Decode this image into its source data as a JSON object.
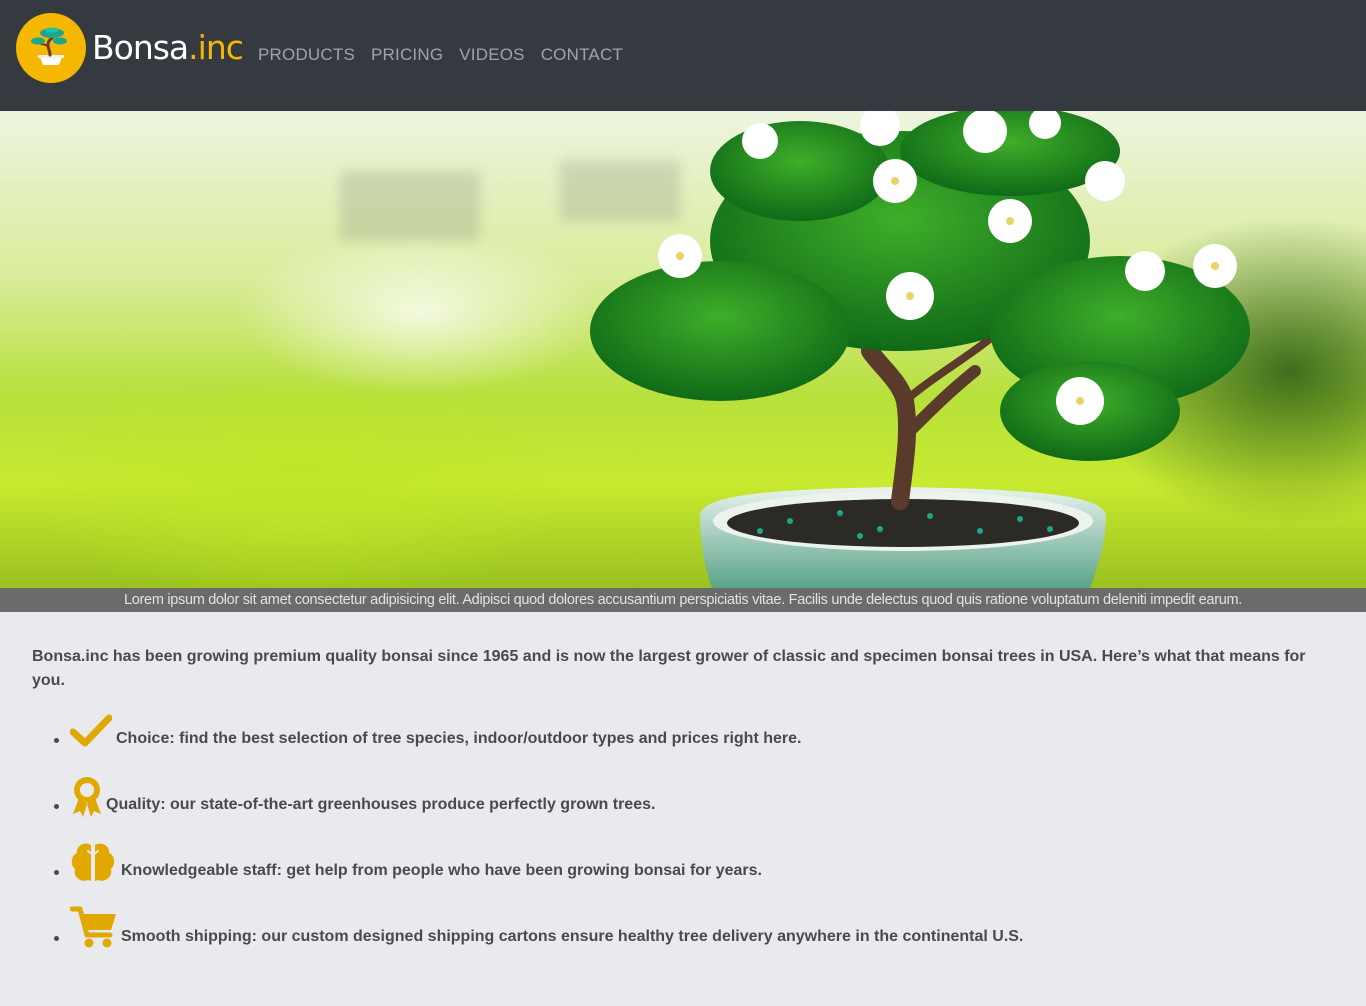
{
  "header": {
    "brand_main": "Bonsa",
    "brand_accent": ".inc",
    "logo_icon": "bonsai-logo-icon",
    "nav": [
      {
        "label": "PRODUCTS"
      },
      {
        "label": "PRICING"
      },
      {
        "label": "VIDEOS"
      },
      {
        "label": "CONTACT"
      }
    ]
  },
  "hero": {
    "image": "bonsai-tree-hero-image",
    "caption": "Lorem ipsum dolor sit amet consectetur adipisicing elit. Adipisci quod dolores accusantium perspiciatis vitae. Facilis unde delectus quod quis ratione voluptatum deleniti impedit earum."
  },
  "main": {
    "intro": "Bonsa.inc has been growing premium quality bonsai since 1965 and is now the largest grower of classic and specimen bonsai trees in USA. Here’s what that means for you.",
    "features": [
      {
        "icon": "checkmark-icon",
        "text": "Choice: find the best selection of tree species, indoor/outdoor types and prices right here."
      },
      {
        "icon": "award-ribbon-icon",
        "text": "Quality: our state-of-the-art greenhouses produce perfectly grown trees."
      },
      {
        "icon": "brain-icon",
        "text": "Knowledgeable staff: get help from people who have been growing bonsai for years."
      },
      {
        "icon": "shopping-cart-icon",
        "text": "Smooth shipping: our custom designed shipping cartons ensure healthy tree delivery anywhere in the continental U.S."
      }
    ]
  },
  "colors": {
    "header_bg": "#343a40",
    "accent": "#f5b700",
    "page_bg": "#e8eaee",
    "text": "#4a4a4a",
    "caption_bar": "#6b6b6b"
  }
}
